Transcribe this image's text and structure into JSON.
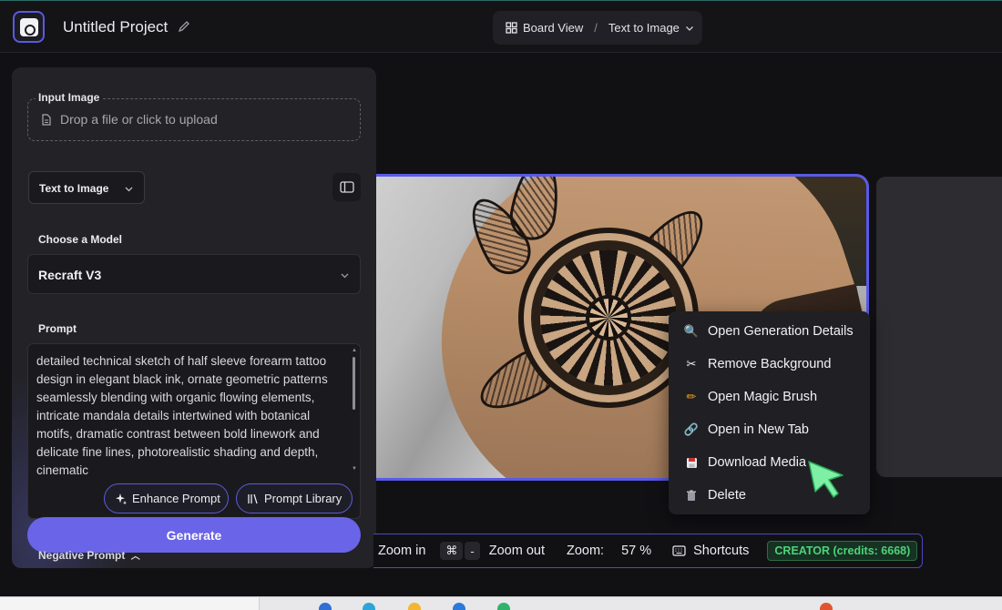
{
  "header": {
    "project_title": "Untitled Project",
    "view_mode": "Board View",
    "separator": "/",
    "current_tool": "Text to Image"
  },
  "panel": {
    "input_image_label": "Input Image",
    "upload_placeholder": "Drop a file or click to upload",
    "mode_select": "Text to Image",
    "model_label": "Choose a Model",
    "model_value": "Recraft V3",
    "prompt_label": "Prompt",
    "prompt_text": "detailed technical sketch of half sleeve forearm tattoo design in elegant black ink, ornate geometric patterns seamlessly blending with organic flowing elements, intricate mandala details intertwined with botanical motifs, dramatic contrast between bold linework and delicate fine lines, photorealistic shading and depth, cinematic",
    "enhance_prompt": "Enhance Prompt",
    "prompt_library": "Prompt Library",
    "generate": "Generate",
    "negative_prompt": "Negative Prompt"
  },
  "context_menu": {
    "items": [
      {
        "label": "Open Generation Details",
        "icon": "magnifier-icon"
      },
      {
        "label": "Remove Background",
        "icon": "scissors-icon"
      },
      {
        "label": "Open Magic Brush",
        "icon": "pencil-icon"
      },
      {
        "label": "Open in New Tab",
        "icon": "link-icon"
      },
      {
        "label": "Download Media",
        "icon": "floppy-disk-icon"
      },
      {
        "label": "Delete",
        "icon": "trash-icon"
      }
    ]
  },
  "toolbar": {
    "zoom_in": "Zoom in",
    "cmd_key": "⌘",
    "minus_key": "-",
    "zoom_out": "Zoom out",
    "zoom_label": "Zoom:",
    "zoom_value": "57 %",
    "shortcuts": "Shortcuts",
    "credits": "CREATOR (credits: 6668)"
  },
  "colors": {
    "accent": "#6a64e8",
    "frame": "#5a5ae8",
    "credits_green": "#4fd27a",
    "cursor_green": "#7ef0a3"
  }
}
